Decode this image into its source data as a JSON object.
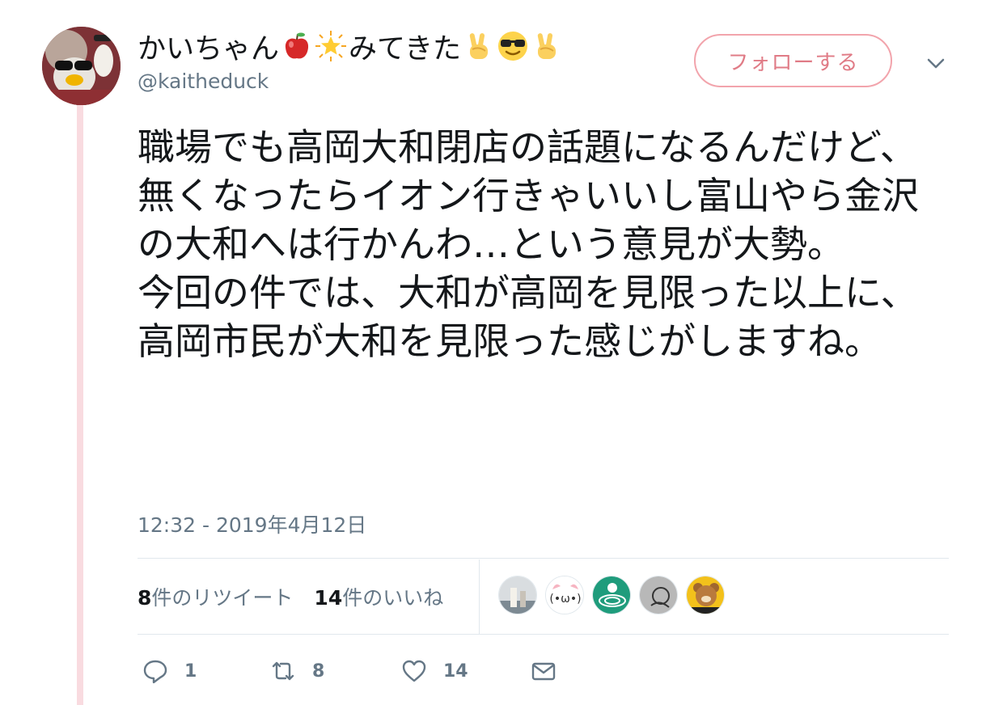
{
  "tweet": {
    "display_name": "かいちゃん",
    "display_name_suffix": "みてきた",
    "name_emojis": [
      "apple-icon",
      "glowing-star-icon",
      "victory-hand-icon",
      "sunglasses-face-icon",
      "victory-hand-icon"
    ],
    "handle": "@kaitheduck",
    "follow_label": "フォローする",
    "text": "職場でも高岡大和閉店の話題になるんだけど、無くなったらイオン行きゃいいし富山やら金沢の大和へは行かんわ…という意見が大勢。\n今回の件では、大和が高岡を見限った以上に、高岡市民が大和を見限った感じがしますね。",
    "timestamp": "12:32 - 2019年4月12日"
  },
  "stats": {
    "retweet_count": "8",
    "retweet_label": "件のリツイート",
    "like_count": "14",
    "like_label": "件のいいね"
  },
  "actions": {
    "reply_count": "1",
    "retweet_count": "8",
    "like_count": "14"
  },
  "colors": {
    "follow_accent": "#e07b86",
    "thread_line": "#f9dbe0",
    "secondary_text": "#657786"
  }
}
